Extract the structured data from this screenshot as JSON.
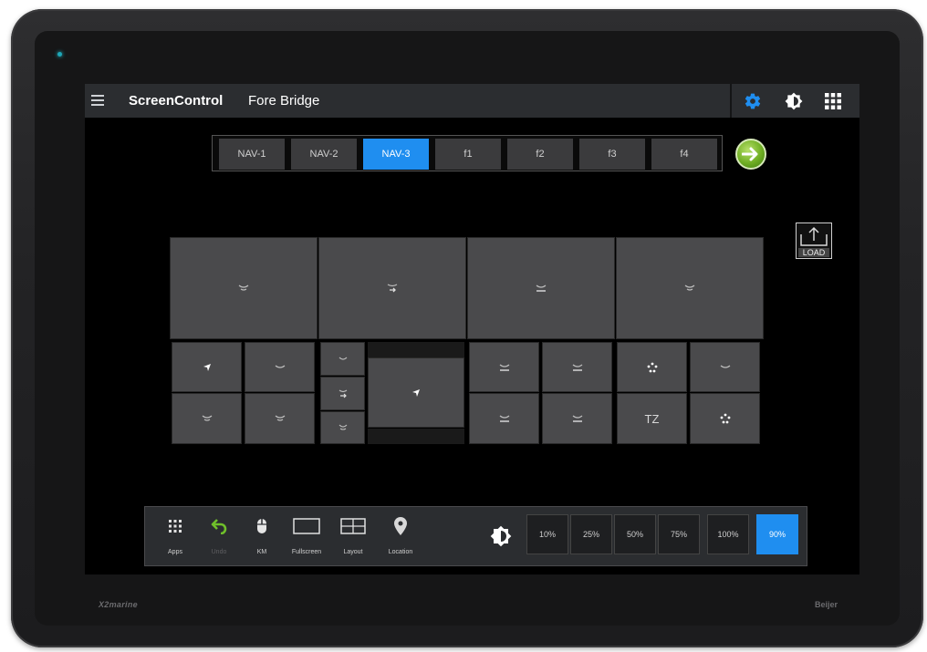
{
  "device": {
    "brand_left": "X2marine",
    "brand_right": "Beijer"
  },
  "header": {
    "app_name": "ScreenControl",
    "location": "Fore Bridge",
    "icons": [
      "menu-icon",
      "settings-gear-icon",
      "brightness-icon",
      "apps-grid-icon"
    ],
    "accent": "#1f8ef0"
  },
  "tabs": [
    {
      "label": "NAV-1",
      "active": false
    },
    {
      "label": "NAV-2",
      "active": false
    },
    {
      "label": "NAV-3",
      "active": true
    },
    {
      "label": "f1",
      "active": false
    },
    {
      "label": "f2",
      "active": false
    },
    {
      "label": "f3",
      "active": false
    },
    {
      "label": "f4",
      "active": false
    }
  ],
  "load_button": {
    "label": "LOAD"
  },
  "grid": {
    "tz_label": "TZ"
  },
  "toolbar": {
    "apps": "Apps",
    "undo": "Undo",
    "km": "KM",
    "fullscreen": "Fullscreen",
    "layout": "Layout",
    "location": "Location",
    "brightness_levels": [
      "10%",
      "25%",
      "50%",
      "75%",
      "100%",
      "90%"
    ],
    "active_brightness": "90%"
  }
}
